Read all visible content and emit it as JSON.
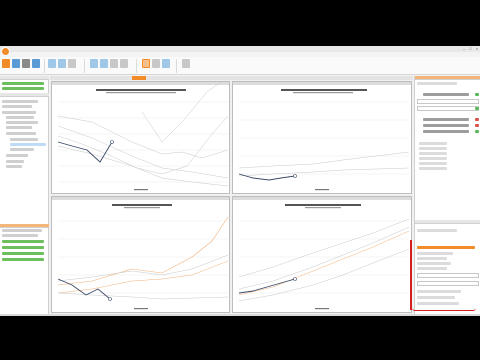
{
  "window": {
    "title": "",
    "controls": [
      "–",
      "□",
      "×"
    ]
  },
  "menu": {
    "items": []
  },
  "ribbon": {
    "groups": []
  },
  "colors": {
    "accent": "#f28c28",
    "series_dark": "#3a4a66",
    "series_light": "#c8c8c8",
    "series_orange": "#f2b27a",
    "annotation": "#d42020"
  }
}
